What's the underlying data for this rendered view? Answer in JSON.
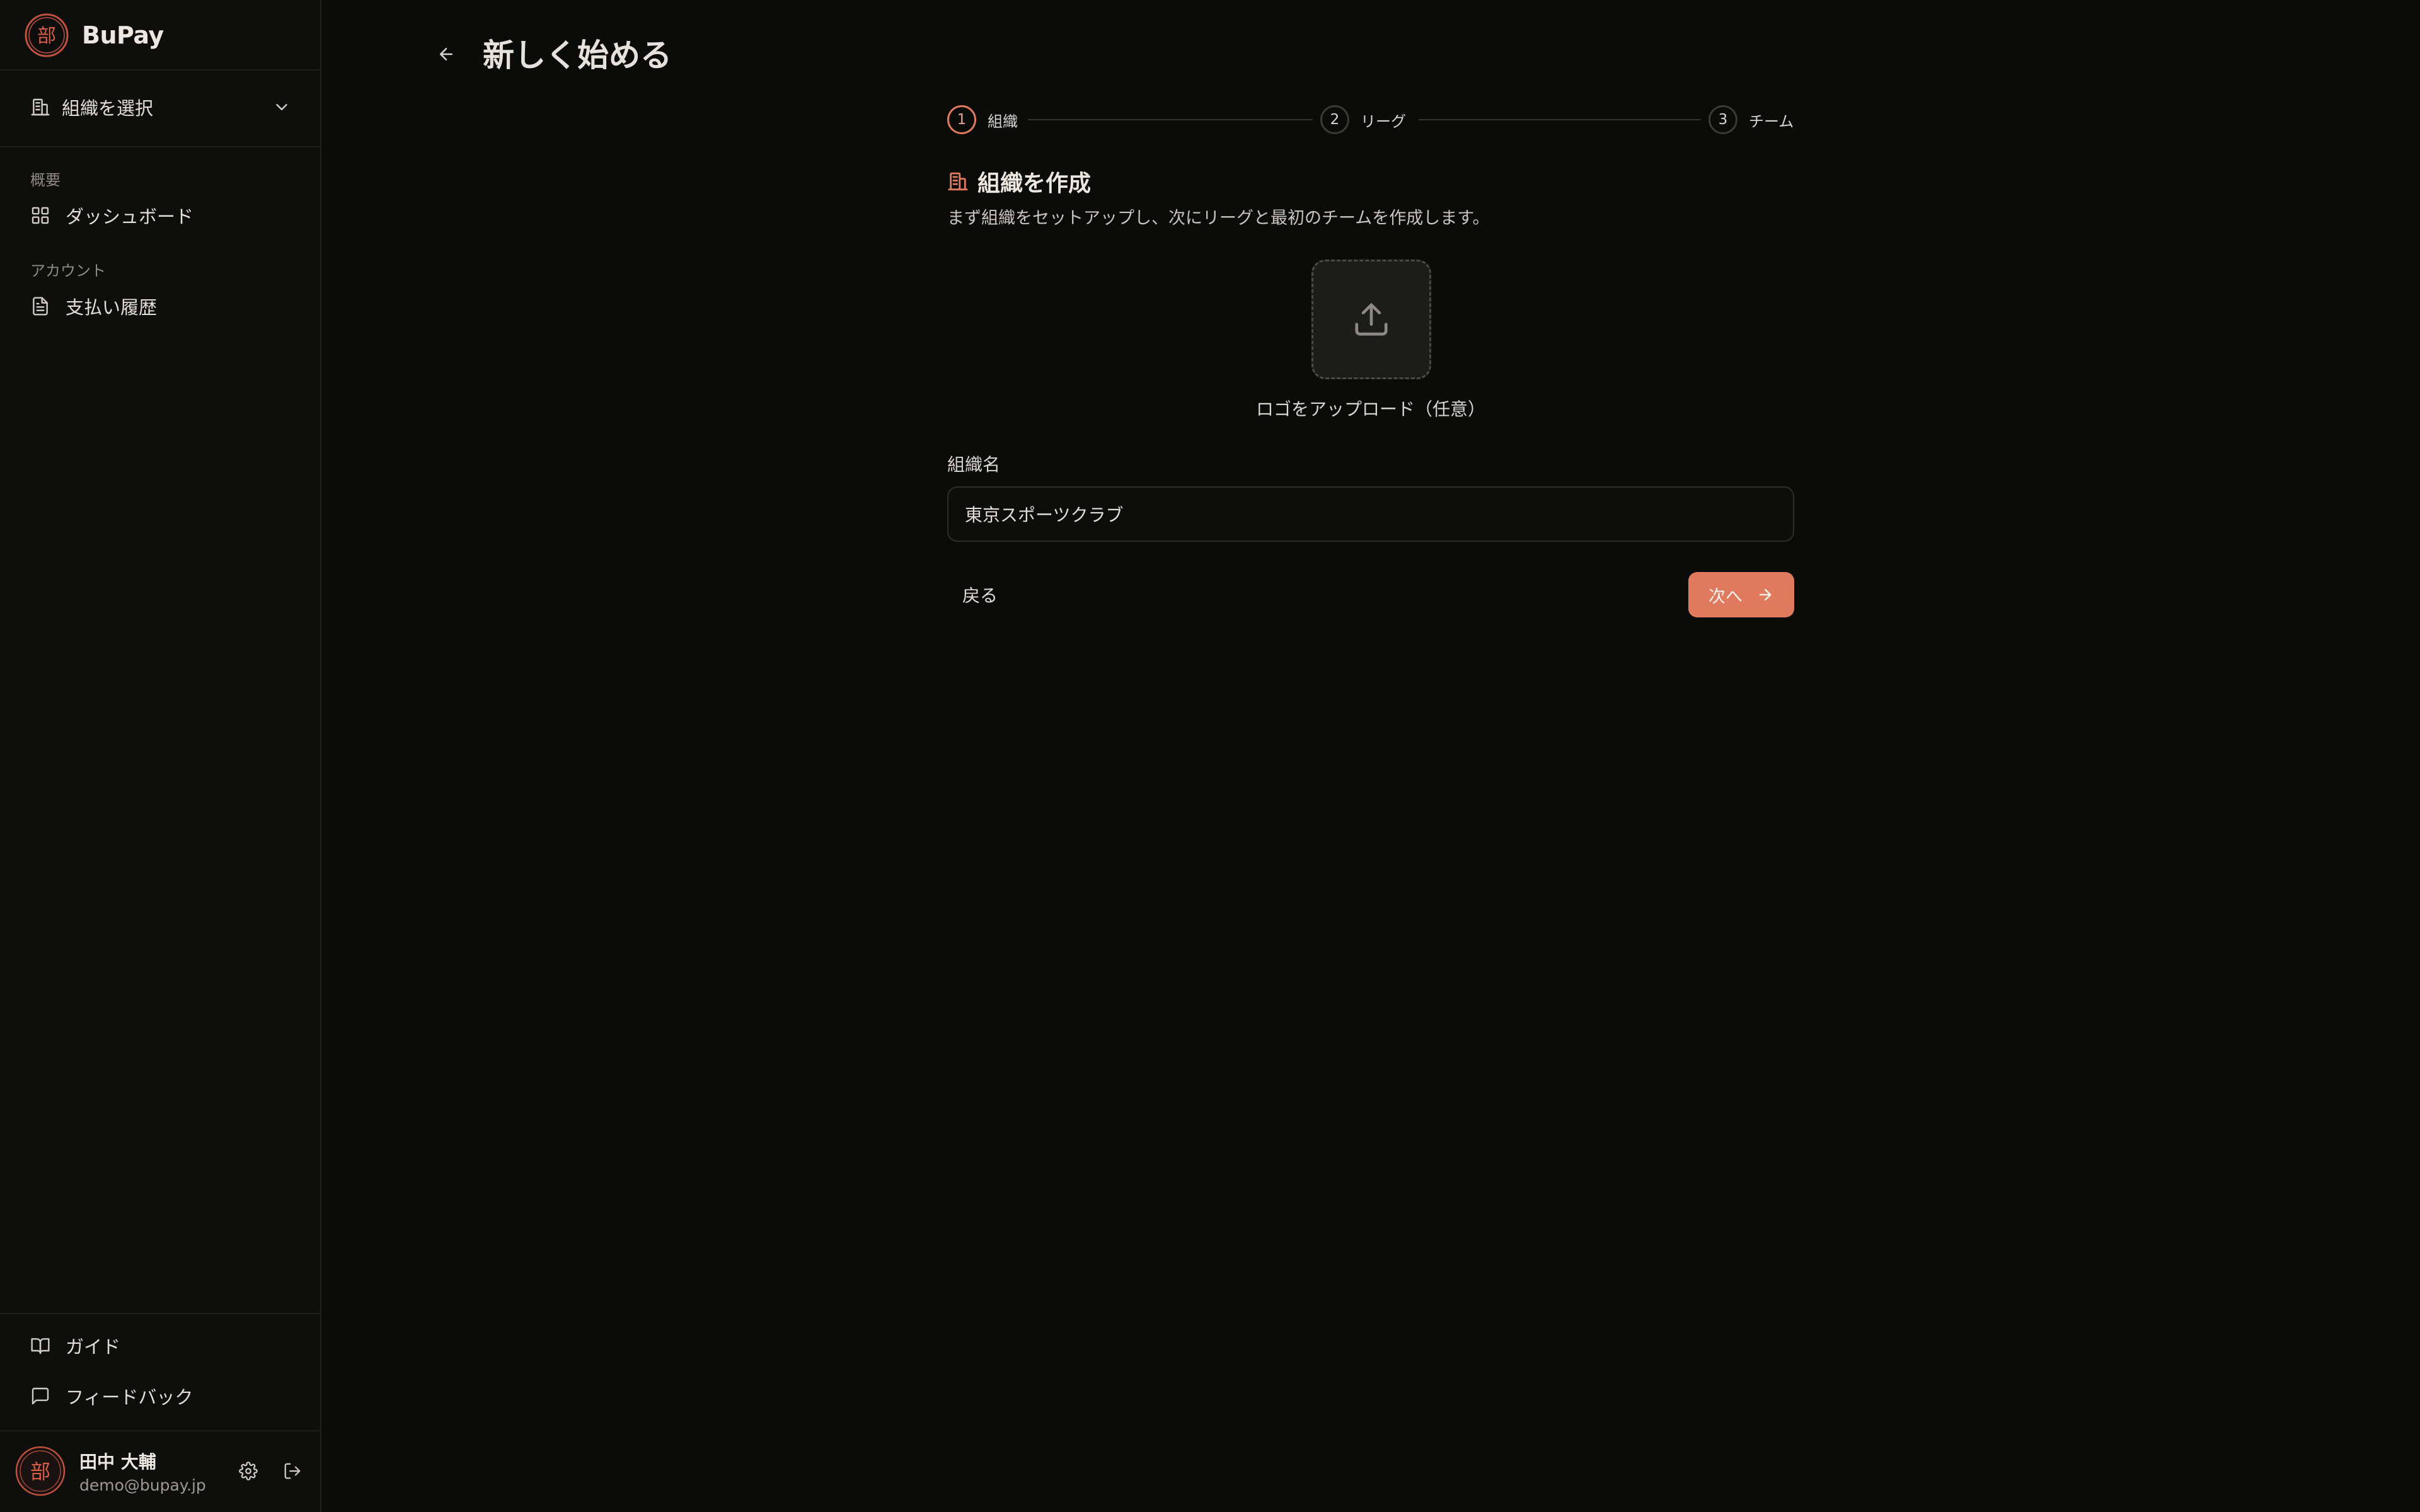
{
  "app": {
    "name": "BuPay",
    "logo_char": "部"
  },
  "sidebar": {
    "org_select_label": "組織を選択",
    "sections": [
      {
        "label": "概要",
        "items": [
          {
            "label": "ダッシュボード",
            "icon": "grid-icon"
          }
        ]
      },
      {
        "label": "アカウント",
        "items": [
          {
            "label": "支払い履歴",
            "icon": "document-icon"
          }
        ]
      }
    ],
    "footer_items": [
      {
        "label": "ガイド",
        "icon": "book-icon"
      },
      {
        "label": "フィードバック",
        "icon": "message-icon"
      }
    ],
    "user": {
      "name": "田中 大輔",
      "email": "demo@bupay.jp"
    }
  },
  "page": {
    "title": "新しく始める"
  },
  "stepper": {
    "steps": [
      {
        "number": "1",
        "label": "組織",
        "active": true
      },
      {
        "number": "2",
        "label": "リーグ",
        "active": false
      },
      {
        "number": "3",
        "label": "チーム",
        "active": false
      }
    ]
  },
  "form": {
    "heading": "組織を作成",
    "description": "まず組織をセットアップし、次にリーグと最初のチームを作成します。",
    "upload_label": "ロゴをアップロード（任意）",
    "org_name_label": "組織名",
    "org_name_value": "東京スポーツクラブ",
    "back_label": "戻る",
    "next_label": "次へ"
  },
  "colors": {
    "accent": "#e07a5f",
    "background": "#0b0b0a",
    "sidebar": "#0e0e0d"
  }
}
